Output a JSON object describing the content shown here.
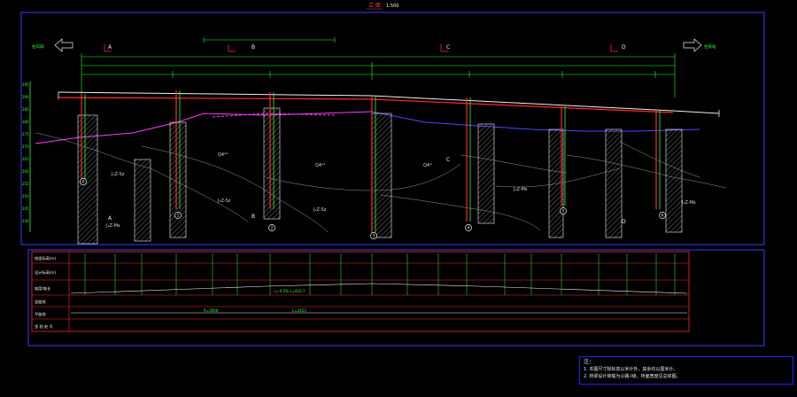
{
  "drawing": {
    "title": "立 面",
    "scale": "1:500"
  },
  "directions": {
    "left": "往白城",
    "right": "往某站"
  },
  "sections": [
    "A",
    "A",
    "B",
    "B",
    "C",
    "C",
    "D",
    "D"
  ],
  "axis_labels": [
    "0",
    "1",
    "2",
    "3",
    "4",
    "5",
    "6"
  ],
  "strata": [
    "Q4ᵉᵈ",
    "Q4ᵉᵈ",
    "Q4ᵃˡ",
    "J₃Z-Sz",
    "J₃Z-Sz",
    "J₃Z-Sz",
    "J₃Z-Ms",
    "J₃Z-Ms",
    "J₃Z-Ms"
  ],
  "elevations": [
    "295",
    "290",
    "285",
    "280",
    "275",
    "270",
    "265",
    "260",
    "255",
    "250",
    "245",
    "240"
  ],
  "table_rows": [
    "地面标高(m)",
    "设计标高(m)",
    "坡度/坡长",
    "竖曲线",
    "平曲线",
    "里 程 桩 号"
  ],
  "table_values": [
    "i=-0.5%  L=423.7",
    "R=3000",
    "L=2453"
  ],
  "notes": {
    "title": "注：",
    "lines": [
      "1. 本图尺寸除标高以米计外，其余均以厘米计。",
      "2. 桥梁设计荷载为公路-I级，桥面宽度见总体图。"
    ]
  },
  "colors": {
    "background": "#000000",
    "frame": "#3b3bff",
    "green": "#2dff2d",
    "white": "#f0f0f0",
    "red": "#ff2a2a",
    "magenta": "#ff3cff",
    "blue": "#4a4aff",
    "gray": "#9a9a9a"
  }
}
